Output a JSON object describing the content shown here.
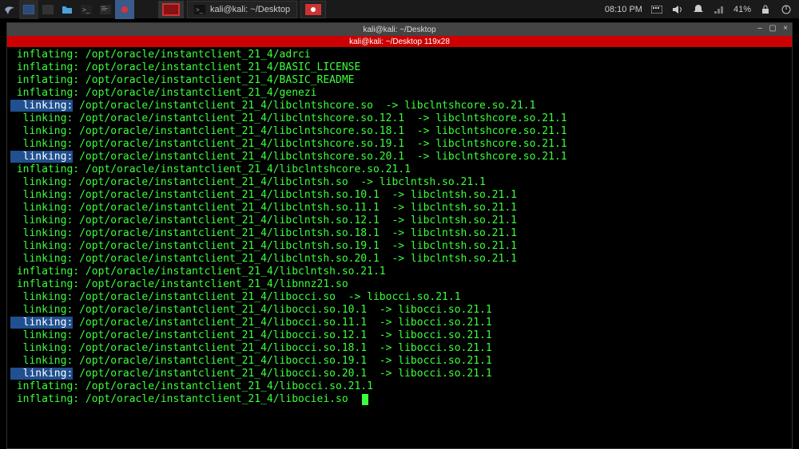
{
  "panel": {
    "taskbar": {
      "label": "kali@kali: ~/Desktop"
    },
    "tray": {
      "clock": "08:10 PM",
      "battery": "41%"
    }
  },
  "window": {
    "title": "kali@kali: ~/Desktop",
    "subtitle": "kali@kali: ~/Desktop 119x28"
  },
  "lines": [
    {
      "action": "inflating:",
      "path": "/opt/oracle/instantclient_21_4/adrci",
      "sel": false
    },
    {
      "action": "inflating:",
      "path": "/opt/oracle/instantclient_21_4/BASIC_LICENSE",
      "sel": false
    },
    {
      "action": "inflating:",
      "path": "/opt/oracle/instantclient_21_4/BASIC_README",
      "sel": false
    },
    {
      "action": "inflating:",
      "path": "/opt/oracle/instantclient_21_4/genezi",
      "sel": false
    },
    {
      "action": "linking:",
      "path": "/opt/oracle/instantclient_21_4/libclntshcore.so  -> libclntshcore.so.21.1",
      "sel": true,
      "indent": true
    },
    {
      "action": "linking:",
      "path": "/opt/oracle/instantclient_21_4/libclntshcore.so.12.1  -> libclntshcore.so.21.1",
      "sel": false,
      "indent": true
    },
    {
      "action": "linking:",
      "path": "/opt/oracle/instantclient_21_4/libclntshcore.so.18.1  -> libclntshcore.so.21.1",
      "sel": false,
      "indent": true
    },
    {
      "action": "linking:",
      "path": "/opt/oracle/instantclient_21_4/libclntshcore.so.19.1  -> libclntshcore.so.21.1",
      "sel": false,
      "indent": true
    },
    {
      "action": "linking:",
      "path": "/opt/oracle/instantclient_21_4/libclntshcore.so.20.1  -> libclntshcore.so.21.1",
      "sel": true,
      "indent": true
    },
    {
      "action": "inflating:",
      "path": "/opt/oracle/instantclient_21_4/libclntshcore.so.21.1",
      "sel": false
    },
    {
      "action": "linking:",
      "path": "/opt/oracle/instantclient_21_4/libclntsh.so  -> libclntsh.so.21.1",
      "sel": false,
      "indent": true
    },
    {
      "action": "linking:",
      "path": "/opt/oracle/instantclient_21_4/libclntsh.so.10.1  -> libclntsh.so.21.1",
      "sel": false,
      "indent": true
    },
    {
      "action": "linking:",
      "path": "/opt/oracle/instantclient_21_4/libclntsh.so.11.1  -> libclntsh.so.21.1",
      "sel": false,
      "indent": true
    },
    {
      "action": "linking:",
      "path": "/opt/oracle/instantclient_21_4/libclntsh.so.12.1  -> libclntsh.so.21.1",
      "sel": false,
      "indent": true
    },
    {
      "action": "linking:",
      "path": "/opt/oracle/instantclient_21_4/libclntsh.so.18.1  -> libclntsh.so.21.1",
      "sel": false,
      "indent": true
    },
    {
      "action": "linking:",
      "path": "/opt/oracle/instantclient_21_4/libclntsh.so.19.1  -> libclntsh.so.21.1",
      "sel": false,
      "indent": true
    },
    {
      "action": "linking:",
      "path": "/opt/oracle/instantclient_21_4/libclntsh.so.20.1  -> libclntsh.so.21.1",
      "sel": false,
      "indent": true
    },
    {
      "action": "inflating:",
      "path": "/opt/oracle/instantclient_21_4/libclntsh.so.21.1",
      "sel": false
    },
    {
      "action": "inflating:",
      "path": "/opt/oracle/instantclient_21_4/libnnz21.so",
      "sel": false
    },
    {
      "action": "linking:",
      "path": "/opt/oracle/instantclient_21_4/libocci.so  -> libocci.so.21.1",
      "sel": false,
      "indent": true
    },
    {
      "action": "linking:",
      "path": "/opt/oracle/instantclient_21_4/libocci.so.10.1  -> libocci.so.21.1",
      "sel": false,
      "indent": true
    },
    {
      "action": "linking:",
      "path": "/opt/oracle/instantclient_21_4/libocci.so.11.1  -> libocci.so.21.1",
      "sel": true,
      "indent": true
    },
    {
      "action": "linking:",
      "path": "/opt/oracle/instantclient_21_4/libocci.so.12.1  -> libocci.so.21.1",
      "sel": false,
      "indent": true
    },
    {
      "action": "linking:",
      "path": "/opt/oracle/instantclient_21_4/libocci.so.18.1  -> libocci.so.21.1",
      "sel": false,
      "indent": true
    },
    {
      "action": "linking:",
      "path": "/opt/oracle/instantclient_21_4/libocci.so.19.1  -> libocci.so.21.1",
      "sel": false,
      "indent": true
    },
    {
      "action": "linking:",
      "path": "/opt/oracle/instantclient_21_4/libocci.so.20.1  -> libocci.so.21.1",
      "sel": true,
      "indent": true
    },
    {
      "action": "inflating:",
      "path": "/opt/oracle/instantclient_21_4/libocci.so.21.1",
      "sel": false
    },
    {
      "action": "inflating:",
      "path": "/opt/oracle/instantclient_21_4/libociei.so",
      "sel": false,
      "cursor": true
    }
  ]
}
